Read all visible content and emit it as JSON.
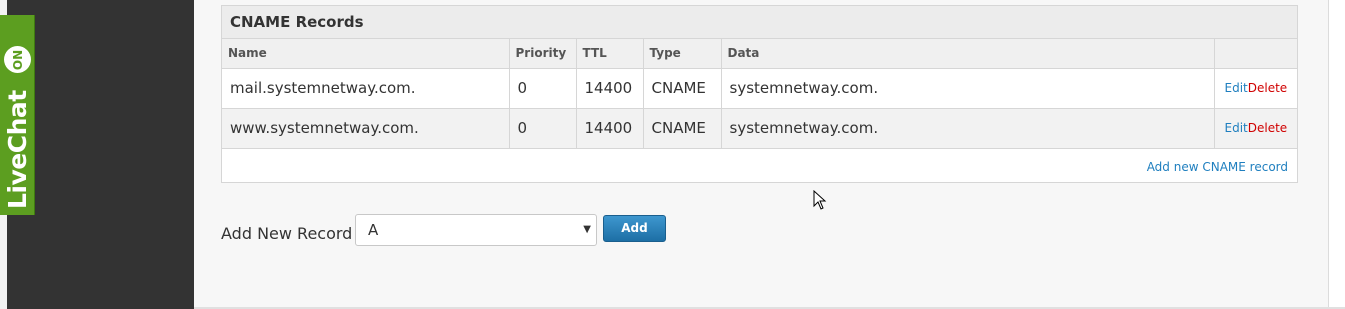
{
  "livechat": {
    "label": "LiveChat",
    "status": "ON"
  },
  "cname_section": {
    "title": "CNAME Records",
    "columns": [
      "Name",
      "Priority",
      "TTL",
      "Type",
      "Data",
      ""
    ],
    "rows": [
      {
        "name": "mail.systemnetway.com.",
        "priority": "0",
        "ttl": "14400",
        "type": "CNAME",
        "data": "systemnetway.com.",
        "edit": "Edit",
        "delete": "Delete"
      },
      {
        "name": "www.systemnetway.com.",
        "priority": "0",
        "ttl": "14400",
        "type": "CNAME",
        "data": "systemnetway.com.",
        "edit": "Edit",
        "delete": "Delete"
      }
    ],
    "add_link": "Add new CNAME record"
  },
  "add_record": {
    "label": "Add New Record",
    "selected_type": "A",
    "button_label": "Add"
  },
  "colors": {
    "livechat_green": "#5c9e20",
    "sidebar_dark": "#333333",
    "link_blue": "#1f7fbf",
    "delete_red": "#d00000",
    "button_blue": "#1d6fa5"
  }
}
